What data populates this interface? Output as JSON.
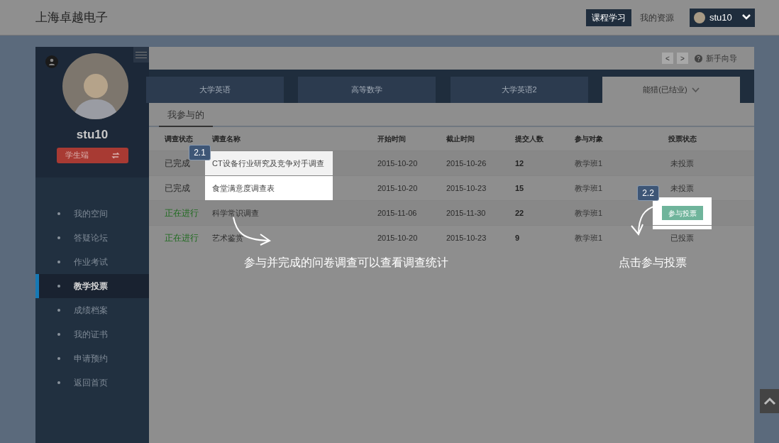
{
  "header": {
    "brand": "上海卓越电子",
    "nav": [
      {
        "label": "课程学习",
        "selected": true
      },
      {
        "label": "我的资源",
        "selected": false
      }
    ],
    "user": "stu10"
  },
  "sidebar": {
    "username": "stu10",
    "role_button": "学生端",
    "items": [
      {
        "label": "我的空间",
        "selected": false
      },
      {
        "label": "答疑论坛",
        "selected": false
      },
      {
        "label": "作业考试",
        "selected": false
      },
      {
        "label": "教学投票",
        "selected": true
      },
      {
        "label": "成绩档案",
        "selected": false
      },
      {
        "label": "我的证书",
        "selected": false
      },
      {
        "label": "申请预约",
        "selected": false
      },
      {
        "label": "返回首页",
        "selected": false
      }
    ]
  },
  "toolbar": {
    "prev": "<",
    "next": ">",
    "help": "新手向导"
  },
  "course_tabs": [
    {
      "label": "大学英语",
      "selected": false,
      "dropdown": false
    },
    {
      "label": "高等数学",
      "selected": false,
      "dropdown": false
    },
    {
      "label": "大学英语2",
      "selected": false,
      "dropdown": false
    },
    {
      "label": "能猎(已结业)",
      "selected": true,
      "dropdown": true
    }
  ],
  "sub_tabs": [
    {
      "label": "我参与的",
      "selected": true
    }
  ],
  "table": {
    "columns": [
      "调查状态",
      "调查名称",
      "开始时间",
      "截止时间",
      "提交人数",
      "参与对象",
      "投票状态"
    ],
    "rows": [
      {
        "status": "已完成",
        "color": "#2a2a2a",
        "name": "CT设备行业研究及竞争对手调查",
        "start": "2015-10-20",
        "end": "2015-10-26",
        "count": "12",
        "target": "教学班1",
        "vote": {
          "kind": "text",
          "label": "未投票"
        },
        "highlighted": true
      },
      {
        "status": "已完成",
        "color": "#2a2a2a",
        "name": "食堂满意度调查表",
        "start": "2015-10-20",
        "end": "2015-10-23",
        "count": "15",
        "target": "教学班1",
        "vote": {
          "kind": "text",
          "label": "未投票"
        },
        "highlighted": true
      },
      {
        "status": "正在进行",
        "color": "#1e6b1e",
        "name": "科学常识调查",
        "start": "2015-11-06",
        "end": "2015-11-30",
        "count": "22",
        "target": "教学班1",
        "vote": {
          "kind": "button",
          "label": "参与投票"
        },
        "highlighted": false
      },
      {
        "status": "正在进行",
        "color": "#1e6b1e",
        "name": "艺术鉴赏",
        "start": "2015-10-20",
        "end": "2015-10-23",
        "count": "9",
        "target": "教学班1",
        "vote": {
          "kind": "text",
          "label": "已投票"
        },
        "highlighted": false
      }
    ]
  },
  "guide": [
    {
      "badge": "2.1",
      "caption": "参与并完成的问卷调查可以查看调查统计"
    },
    {
      "badge": "2.2",
      "caption": "点击参与投票"
    }
  ]
}
